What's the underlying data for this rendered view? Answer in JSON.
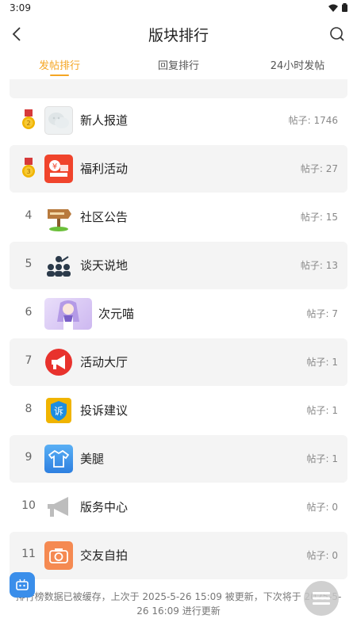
{
  "status_bar": {
    "time": "3:09"
  },
  "header": {
    "title": "版块排行"
  },
  "tabs": [
    {
      "label": "发帖排行",
      "active": true
    },
    {
      "label": "回复排行",
      "active": false
    },
    {
      "label": "24小时发帖",
      "active": false
    }
  ],
  "rankings": [
    {
      "rank": "2",
      "medal": "silver-medal-icon",
      "name": "新人报道",
      "count": "帖子: 1746",
      "icon": "wechat-bubble-icon"
    },
    {
      "rank": "3",
      "medal": "bronze-medal-icon",
      "name": "福利活动",
      "count": "帖子: 27",
      "icon": "gift-yuan-icon"
    },
    {
      "rank": "4",
      "name": "社区公告",
      "count": "帖子: 15",
      "icon": "signpost-icon"
    },
    {
      "rank": "5",
      "name": "谈天说地",
      "count": "帖子: 13",
      "icon": "people-chat-icon"
    },
    {
      "rank": "6",
      "name": "次元喵",
      "count": "帖子: 7",
      "icon": "anime-girl-image"
    },
    {
      "rank": "7",
      "name": "活动大厅",
      "count": "帖子: 1",
      "icon": "megaphone-red-icon"
    },
    {
      "rank": "8",
      "name": "投诉建议",
      "count": "帖子: 1",
      "icon": "complaint-shield-icon"
    },
    {
      "rank": "9",
      "name": "美腿",
      "count": "帖子: 1",
      "icon": "tshirt-icon"
    },
    {
      "rank": "10",
      "name": "版务中心",
      "count": "帖子: 0",
      "icon": "megaphone-gray-icon"
    },
    {
      "rank": "11",
      "name": "交友自拍",
      "count": "帖子: 0",
      "icon": "camera-icon"
    }
  ],
  "footer": {
    "note": "排行榜数据已被缓存，上次于 2025-5-26 15:09 被更新，下次将于 2025-5-26 16:09 进行更新"
  },
  "colors": {
    "accent": "#f5a623",
    "fab_blue": "#3a8eea"
  }
}
